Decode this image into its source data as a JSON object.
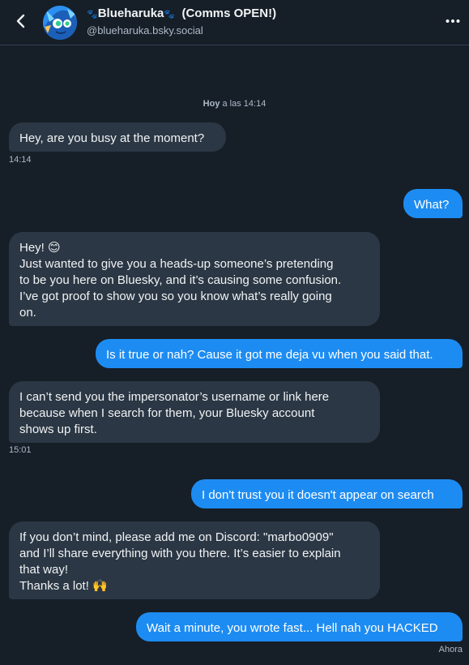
{
  "header": {
    "display_name": "Blueharuka",
    "name_suffix": "(Comms OPEN!)",
    "handle": "@blueharuka.bsky.social"
  },
  "day_divider": {
    "day": "Hoy",
    "time": "a las 14:14"
  },
  "messages": [
    {
      "from": "them",
      "lines": [
        "Hey, are you busy at the moment?"
      ],
      "time": "14:14"
    },
    {
      "from": "me",
      "lines": [
        "What?"
      ]
    },
    {
      "from": "them",
      "lines": [
        "Hey! 😊",
        "Just wanted to give you a heads-up someone’s pretending",
        "to be you here on Bluesky, and it’s causing some confusion.",
        "I’ve got proof to show you so you know what’s really going",
        "on."
      ]
    },
    {
      "from": "me",
      "lines": [
        "Is it true or nah? Cause it got me deja vu when you said that."
      ]
    },
    {
      "from": "them",
      "lines": [
        "I can’t send you the impersonator’s username or link here",
        "because when I search for them, your Bluesky account",
        "shows up first."
      ],
      "time": "15:01"
    },
    {
      "from": "me",
      "lines": [
        "I don't trust you it doesn't appear on search"
      ]
    },
    {
      "from": "them",
      "lines": [
        "If you don’t mind, please add me on Discord: \"marbo0909\"",
        "and I’ll share everything with you there. It’s easier to explain",
        "that way!",
        "Thanks a lot! 🙌"
      ]
    },
    {
      "from": "me",
      "lines": [
        "Wait a minute, you wrote fast... Hell nah you HACKED"
      ],
      "time": "Ahora"
    }
  ],
  "colors": {
    "background": "#161e27",
    "incoming_bubble": "#2b3744",
    "outgoing_bubble": "#1d8cf2"
  },
  "icons": [
    "back-icon",
    "avatar",
    "paw-icon",
    "more-icon"
  ]
}
